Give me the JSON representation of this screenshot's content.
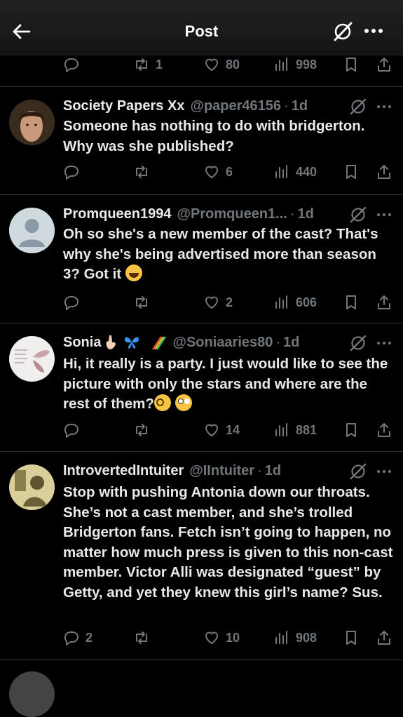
{
  "header": {
    "title": "Post"
  },
  "top_actions": {
    "reply": "",
    "repost": "1",
    "like": "80",
    "views": "998"
  },
  "posts": [
    {
      "name": "Society Papers Xx",
      "handle": "@paper46156",
      "dot": "·",
      "time": "1d",
      "text": "Someone has nothing to do with bridgerton. Why was she published?",
      "reply": "",
      "repost": "",
      "like": "6",
      "views": "440"
    },
    {
      "name": "Promqueen1994",
      "handle": "@Promqueen1...",
      "dot": "·",
      "time": "1d",
      "text": "Oh so she's a new member of the cast? That's why she's being advertised more than season 3? Got it",
      "reply": "",
      "repost": "",
      "like": "2",
      "views": "606"
    },
    {
      "name": "Sonia",
      "handle": "@Soniaaries80",
      "dot": "·",
      "time": "1d",
      "text": "Hi, it really is a party. I just would like to see the picture with only the stars  and where are the rest of them?",
      "reply": "",
      "repost": "",
      "like": "14",
      "views": "881"
    },
    {
      "name": "IntrovertedIntuiter",
      "handle": "@IIntuiter",
      "dot": "·",
      "time": "1d",
      "text": "Stop with pushing Antonia down our throats. She’s not a cast member, and she’s trolled Bridgerton fans. Fetch isn’t going to happen, no matter how much press is given to this non-cast member. Victor Alli was designated “guest” by Getty, and yet they knew this girl’s name? Sus.",
      "reply": "2",
      "repost": "",
      "like": "10",
      "views": "908"
    }
  ],
  "icons": {
    "back": "arrow-left-icon",
    "grok": "grok-icon",
    "more": "more-icon",
    "reply": "reply-icon",
    "repost": "repost-icon",
    "like": "heart-icon",
    "views": "views-icon",
    "bookmark": "bookmark-icon",
    "share": "share-icon"
  },
  "colors": {
    "background": "#000000",
    "text": "#e7e9ea",
    "muted": "#71767b",
    "divider": "#2f3336"
  }
}
